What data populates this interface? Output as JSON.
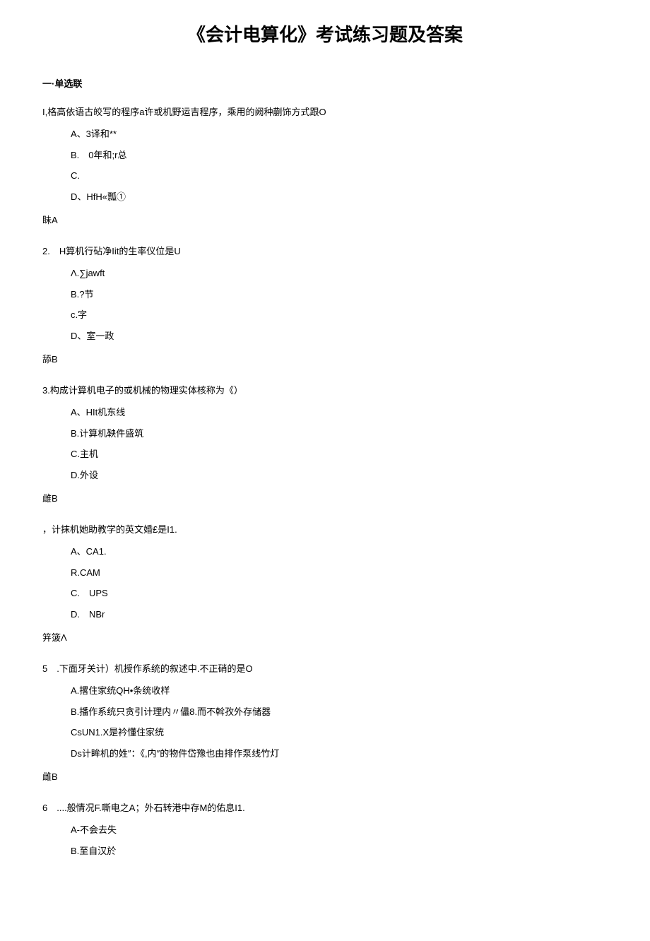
{
  "title": "《会计电算化》考试练习题及答案",
  "section_header": "一·单选联",
  "q1": {
    "text": "I,格高依语古皎写的程序a许或机野运吉程序，乘用的阙种蒯饰方式跟O",
    "a": "A、3译和**",
    "b": "B.　0年和;r总",
    "c": "C.",
    "d": "D、HfH«瓢①",
    "ans": "眛A"
  },
  "q2": {
    "text": "2.　H算机行砧净Iit的生率仪位是U",
    "a": "Λ.∑jawft",
    "b": "B.?节",
    "c": "c.字",
    "d": "D、室一政",
    "ans": "舔B"
  },
  "q3": {
    "text": "3.构成计算机电子的或机械的物理实体核称为《）",
    "a": "A、HIt机东线",
    "b": "B.计算机鞅件盛筑",
    "c": "C.主机",
    "d": "D.外设",
    "ans": "雌B"
  },
  "q4": {
    "text": "，计抹机她助教学的英文婚£是I1.",
    "a": "A、CA1.",
    "b": "R.CAM",
    "c": "C.　UPS",
    "d": "D.　NBr",
    "ans": "笄箥Λ"
  },
  "q5": {
    "text": "5　.下面牙关计）机授作系统的叙述中.不正硝的是O",
    "a": "A.撂住家统QH•条统收样",
    "b": "B.播作系统只贪引计理内〃儡8.而不斡孜外存储器",
    "c": "CsUN1.X是衿懂住家统",
    "d": "Ds计眸机的姓″：《,内″的物件岱豫也由排作泵线竹灯",
    "ans": "雌B"
  },
  "q6": {
    "text": "6　....般情况F.嘶电之A；外石转港中存M的佑息I1.",
    "a": "A-不会去失",
    "b": "B.至自汉於"
  }
}
